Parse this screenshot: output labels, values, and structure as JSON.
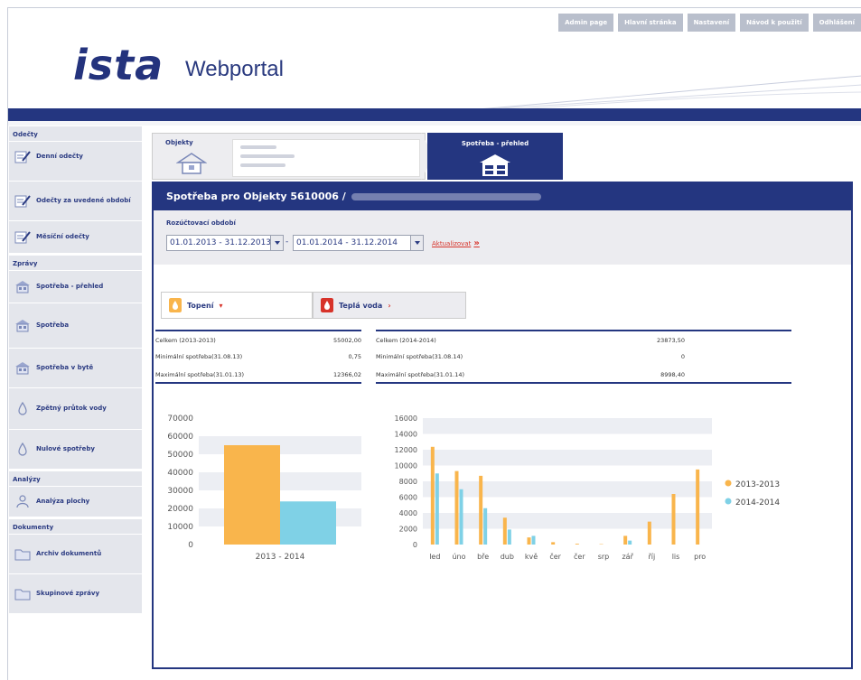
{
  "header": {
    "logo": "ista",
    "product": "Webportal",
    "nav": [
      "Admin page",
      "Hlavní stránka",
      "Nastavení",
      "Návod k použití",
      "Odhlášení"
    ]
  },
  "sidebar": {
    "sections": [
      {
        "title": "Odečty",
        "items": [
          "Denní odečty",
          "Odečty za uvedené období",
          "Měsíční odečty"
        ]
      },
      {
        "title": "Zprávy",
        "items": [
          "Spotřeba - přehled",
          "Spotřeba",
          "Spotřeba v bytě",
          "Zpětný průtok vody",
          "Nulové spotřeby"
        ]
      },
      {
        "title": "Analýzy",
        "items": [
          "Analýza plochy"
        ]
      },
      {
        "title": "Dokumenty",
        "items": [
          "Archiv dokumentů",
          "Skupinové zprávy"
        ]
      }
    ]
  },
  "tabs": {
    "objekty": "Objekty",
    "spotreba": "Spotřeba - přehled"
  },
  "panel": {
    "title": "Spotřeba pro Objekty 5610006 /",
    "period_label": "Rozúčtovací období",
    "period_from": "01.01.2013 - 31.12.2013",
    "period_dash": "-",
    "period_to": "01.01.2014 - 31.12.2014",
    "update_label": "Aktualizovat",
    "media_tabs": [
      "Topení",
      "Teplá voda"
    ]
  },
  "stats": {
    "left": [
      {
        "label": "Celkem (2013-2013)",
        "value": "55002,00"
      },
      {
        "label": "Minimální spotřeba(31.08.13)",
        "value": "0,75"
      },
      {
        "label": "Maximální spotřeba(31.01.13)",
        "value": "12366,02"
      }
    ],
    "right": [
      {
        "label": "Celkem (2014-2014)",
        "value": "23873,50"
      },
      {
        "label": "Minimální spotřeba(31.08.14)",
        "value": "0"
      },
      {
        "label": "Maximální spotřeba(31.01.14)",
        "value": "8998,40"
      }
    ]
  },
  "colors": {
    "brand": "#243680",
    "series_2013": "#f9b54c",
    "series_2014": "#7fd1e6"
  },
  "chart_data": [
    {
      "type": "bar",
      "categories": [
        "2013 - 2014"
      ],
      "series": [
        {
          "name": "2013-2013",
          "values": [
            55002
          ]
        },
        {
          "name": "2014-2014",
          "values": [
            23873.5
          ]
        }
      ],
      "yticks": [
        "0",
        "10000",
        "20000",
        "30000",
        "40000",
        "50000",
        "60000",
        "70000"
      ],
      "ylim": [
        0,
        70000
      ],
      "grid": true,
      "legend": "none"
    },
    {
      "type": "bar",
      "categories": [
        "led",
        "úno",
        "bře",
        "dub",
        "kvě",
        "čer",
        "čer",
        "srp",
        "zář",
        "říj",
        "lis",
        "pro"
      ],
      "series": [
        {
          "name": "2013-2013",
          "values": [
            12366,
            9300,
            8700,
            3400,
            900,
            300,
            100,
            50,
            1100,
            2900,
            6400,
            9500
          ]
        },
        {
          "name": "2014-2014",
          "values": [
            8998,
            7000,
            4600,
            1900,
            1100,
            0,
            0,
            0,
            500,
            0,
            0,
            0
          ]
        }
      ],
      "yticks": [
        "0",
        "2000",
        "4000",
        "6000",
        "8000",
        "10000",
        "12000",
        "14000",
        "16000"
      ],
      "ylim": [
        0,
        16000
      ],
      "grid": true,
      "legend": "right"
    }
  ]
}
